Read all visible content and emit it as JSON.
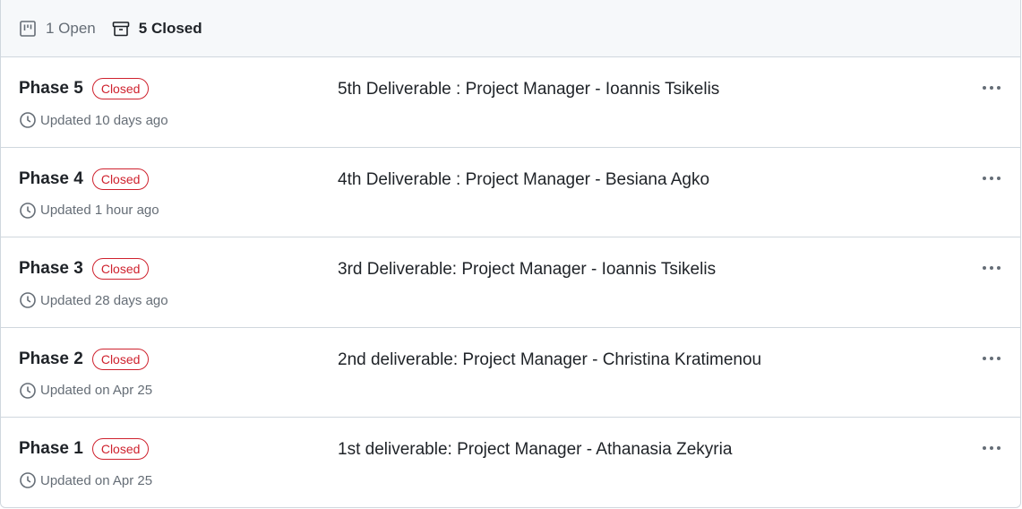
{
  "filters": {
    "open_label": "1 Open",
    "closed_label": "5 Closed"
  },
  "milestones": [
    {
      "name": "Phase 5",
      "status": "Closed",
      "updated": "Updated 10 days ago",
      "description": "5th Deliverable : Project Manager - Ioannis Tsikelis"
    },
    {
      "name": "Phase 4",
      "status": "Closed",
      "updated": "Updated 1 hour ago",
      "description": "4th Deliverable : Project Manager - Besiana Agko"
    },
    {
      "name": "Phase 3",
      "status": "Closed",
      "updated": "Updated 28 days ago",
      "description": "3rd Deliverable: Project Manager - Ioannis Tsikelis"
    },
    {
      "name": "Phase 2",
      "status": "Closed",
      "updated": "Updated on Apr 25",
      "description": "2nd deliverable: Project Manager - Christina Kratimenou"
    },
    {
      "name": "Phase 1",
      "status": "Closed",
      "updated": "Updated on Apr 25",
      "description": "1st deliverable: Project Manager - Athanasia Zekyria"
    }
  ],
  "colors": {
    "closed_badge": "#cf222e",
    "header_bg": "#f6f8fa",
    "border": "#d0d7de",
    "muted_text": "#656d76"
  },
  "icons": {
    "open": "project-board-icon",
    "closed": "archive-icon",
    "updated": "clock-icon",
    "more": "kebab-horizontal-icon"
  }
}
